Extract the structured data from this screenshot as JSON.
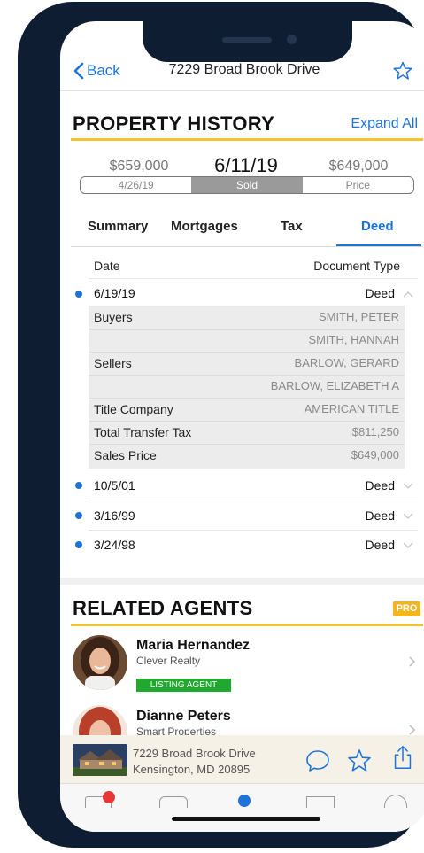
{
  "nav": {
    "back_label": "Back",
    "title": "7229 Broad Brook Drive",
    "favorite_icon": "star-outline-icon"
  },
  "history": {
    "title": "PROPERTY HISTORY",
    "expand_label": "Expand All",
    "left_price": "$659,000",
    "left_date": "4/26/19",
    "main_date": "6/11/19",
    "status": "Sold",
    "right_price": "$649,000",
    "right_label": "Price"
  },
  "tabs": [
    "Summary",
    "Mortgages",
    "Tax",
    "Deed"
  ],
  "active_tab": "Deed",
  "table": {
    "col_date": "Date",
    "col_type": "Document Type",
    "rows": [
      {
        "date": "6/19/19",
        "type": "Deed",
        "expanded": true
      },
      {
        "date": "10/5/01",
        "type": "Deed",
        "expanded": false
      },
      {
        "date": "3/16/99",
        "type": "Deed",
        "expanded": false
      },
      {
        "date": "3/24/98",
        "type": "Deed",
        "expanded": false
      }
    ],
    "details": [
      {
        "label": "Buyers",
        "value": "SMITH, PETER"
      },
      {
        "label": "",
        "value": "SMITH, HANNAH"
      },
      {
        "label": "Sellers",
        "value": "BARLOW, GERARD"
      },
      {
        "label": "",
        "value": "BARLOW, ELIZABETH A"
      },
      {
        "label": "Title Company",
        "value": "AMERICAN TITLE"
      },
      {
        "label": "Total Transfer Tax",
        "value": "$811,250"
      },
      {
        "label": "Sales Price",
        "value": "$649,000"
      }
    ]
  },
  "agents": {
    "title": "RELATED AGENTS",
    "badge": "PRO",
    "list": [
      {
        "name": "Maria Hernandez",
        "company": "Clever Realty",
        "tag": "LISTING AGENT"
      },
      {
        "name": "Dianne Peters",
        "company": "Smart Properties",
        "tag": ""
      }
    ]
  },
  "bottom_card": {
    "address_line1": "7229 Broad Brook Drive",
    "address_line2": "Kensington, MD 20895",
    "icons": [
      "chat-bubble-icon",
      "star-outline-icon",
      "share-icon"
    ]
  },
  "colors": {
    "accent": "#1e73d8",
    "frame": "#0f1d33",
    "section_underline": "#f4c430",
    "pro_badge": "#f4b521",
    "listing_tag": "#22a830"
  }
}
